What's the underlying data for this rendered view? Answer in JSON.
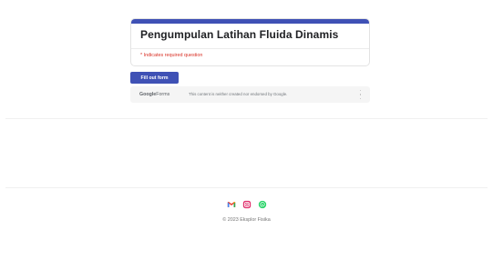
{
  "form": {
    "title": "Pengumpulan Latihan Fluida Dinamis",
    "required_note": "* Indicates required question",
    "accent_color": "#3f51b5"
  },
  "fill_button": {
    "label": "Fill out form"
  },
  "google_forms_bar": {
    "logo_google": "Google",
    "logo_forms": "Forms",
    "disclaimer": "This content is neither created nor endorsed by Google."
  },
  "footer": {
    "social_icons": [
      "gmail-icon",
      "instagram-icon",
      "whatsapp-icon"
    ],
    "copyright": "© 2023 Eksplor Fisika"
  }
}
